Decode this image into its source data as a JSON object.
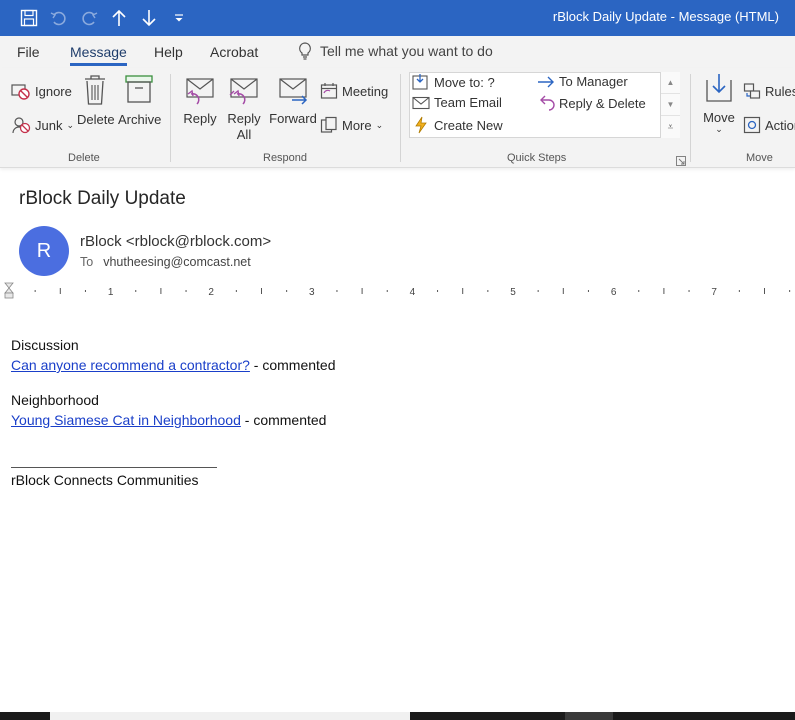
{
  "window": {
    "title": "rBlock Daily Update  -  Message (HTML)"
  },
  "menu": {
    "tabs": [
      "File",
      "Message",
      "Help",
      "Acrobat"
    ],
    "active_tab": "Message",
    "tell_me": "Tell me what you want to do"
  },
  "ribbon": {
    "delete_group": {
      "label": "Delete",
      "ignore": "Ignore",
      "junk": "Junk",
      "delete": "Delete",
      "archive": "Archive"
    },
    "respond_group": {
      "label": "Respond",
      "reply": "Reply",
      "reply_all_1": "Reply",
      "reply_all_2": "All",
      "forward": "Forward",
      "meeting": "Meeting",
      "more": "More"
    },
    "quick_steps": {
      "label": "Quick Steps",
      "move_to": "Move to: ?",
      "team_email": "Team Email",
      "create_new": "Create New",
      "to_manager": "To Manager",
      "reply_delete": "Reply & Delete"
    },
    "move_group": {
      "label": "Move",
      "move": "Move",
      "rules": "Rules",
      "actions": "Actions"
    }
  },
  "message": {
    "subject": "rBlock Daily Update",
    "avatar_initial": "R",
    "sender": "rBlock <rblock@rblock.com>",
    "to_label": "To",
    "to": "vhutheesing@comcast.net"
  },
  "ruler": {
    "labels": [
      "1",
      "2",
      "3",
      "4",
      "5",
      "6",
      "7"
    ]
  },
  "body": {
    "section1_heading": "Discussion",
    "section1_link": "Can anyone recommend a contractor?",
    "section1_suffix": " - commented",
    "section2_heading": "Neighborhood",
    "section2_link": "Young Siamese Cat in Neighborhood",
    "section2_suffix": " - commented",
    "signature": "rBlock Connects Communities"
  },
  "colors": {
    "titlebar": "#2b65c2",
    "link": "#1a3fc9",
    "avatar": "#4b6ee0",
    "ribbon_bg": "#f3f3f3"
  }
}
